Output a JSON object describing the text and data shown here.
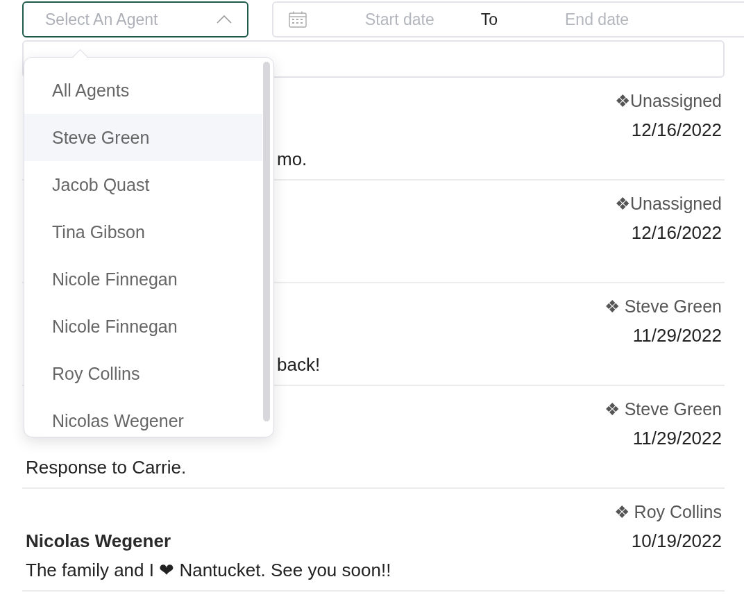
{
  "agent_select": {
    "placeholder": "Select An Agent",
    "expanded": true
  },
  "date_range": {
    "start_placeholder": "Start date",
    "separator": "To",
    "end_placeholder": "End date"
  },
  "agent_menu": {
    "items": [
      {
        "label": "All Agents",
        "selected": false
      },
      {
        "label": "Steve Green",
        "selected": true
      },
      {
        "label": "Jacob Quast",
        "selected": false
      },
      {
        "label": "Tina Gibson",
        "selected": false
      },
      {
        "label": "Nicole Finnegan",
        "selected": false
      },
      {
        "label": "Nicole Finnegan",
        "selected": false
      },
      {
        "label": "Roy Collins",
        "selected": false
      },
      {
        "label": "Nicolas Wegener",
        "selected": false
      }
    ]
  },
  "conversations": [
    {
      "agent": "❖Unassigned",
      "date": "12/16/2022",
      "body": "mo."
    },
    {
      "agent": "❖Unassigned",
      "date": "12/16/2022"
    },
    {
      "agent": "❖ Steve Green",
      "date": "11/29/2022",
      "body": "back!"
    },
    {
      "agent": "❖ Steve Green",
      "date": "11/29/2022",
      "body": "Response to Carrie."
    },
    {
      "agent": "❖ Roy Collins",
      "date": "10/19/2022",
      "name": "Nicolas Wegener",
      "body": "The family and I ❤ Nantucket. See you soon!!"
    }
  ]
}
